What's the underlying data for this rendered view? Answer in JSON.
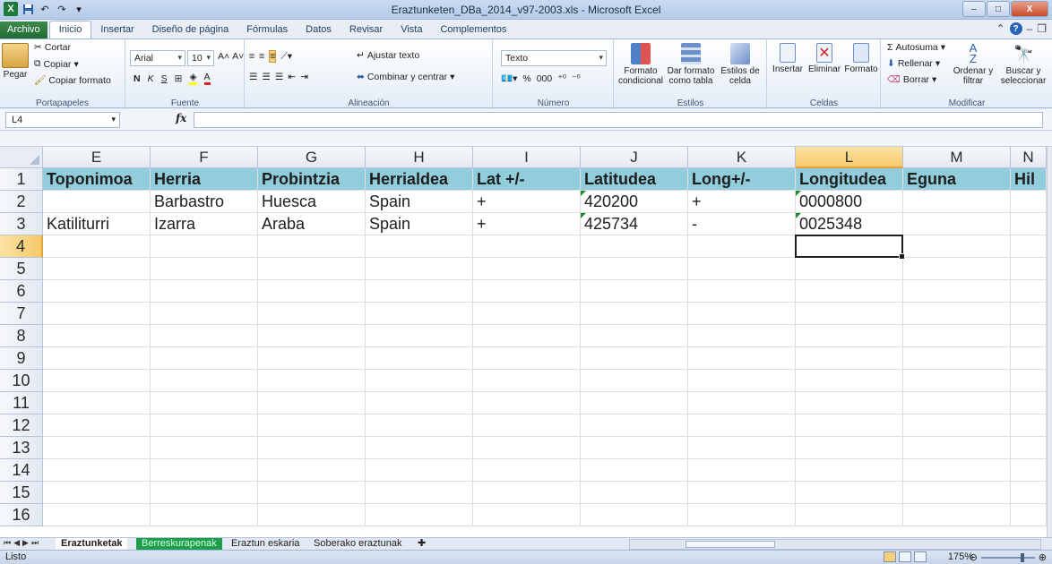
{
  "window": {
    "title": "Eraztunketen_DBa_2014_v97-2003.xls - Microsoft Excel",
    "app_logo": "X",
    "controls": {
      "minimize": "–",
      "maximize": "□",
      "close": "X"
    }
  },
  "ribbon_tabs": [
    "Archivo",
    "Inicio",
    "Insertar",
    "Diseño de página",
    "Fórmulas",
    "Datos",
    "Revisar",
    "Vista",
    "Complementos"
  ],
  "active_tab": "Inicio",
  "ribbon": {
    "clipboard": {
      "paste": "Pegar",
      "cut": "Cortar",
      "copy": "Copiar",
      "copy_format": "Copiar formato",
      "label": "Portapapeles"
    },
    "font": {
      "name": "Arial",
      "size": "10",
      "bold": "N",
      "italic": "K",
      "underline": "S",
      "label": "Fuente"
    },
    "alignment": {
      "wrap": "Ajustar texto",
      "merge": "Combinar y centrar",
      "label": "Alineación"
    },
    "number": {
      "format": "Texto",
      "percent": "%",
      "thousands": "000",
      "label": "Número"
    },
    "styles": {
      "cond_format": "Formato condicional",
      "table_format": "Dar formato como tabla",
      "cell_styles": "Estilos de celda",
      "label": "Estilos"
    },
    "cells": {
      "insert": "Insertar",
      "delete": "Eliminar",
      "format": "Formato",
      "label": "Celdas"
    },
    "editing": {
      "autosum": "Autosuma",
      "fill": "Rellenar",
      "clear": "Borrar",
      "sort": "Ordenar y filtrar",
      "find": "Buscar y seleccionar",
      "label": "Modificar"
    }
  },
  "formula_bar": {
    "name_box": "L4",
    "fx": "fx",
    "formula": ""
  },
  "columns": [
    "E",
    "F",
    "G",
    "H",
    "I",
    "J",
    "K",
    "L",
    "M",
    "N"
  ],
  "selected_column": "L",
  "rows": [
    "1",
    "2",
    "3",
    "4",
    "5",
    "6",
    "7",
    "8",
    "9",
    "10",
    "11",
    "12",
    "13",
    "14",
    "15",
    "16"
  ],
  "selected_row": "4",
  "headers": [
    "Toponimoa",
    "Herria",
    "Probintzia",
    "Herrialdea",
    "Lat +/-",
    "Latitudea",
    "Long+/-",
    "Longitudea",
    "Eguna",
    "Hil"
  ],
  "data_rows": [
    [
      "",
      "Barbastro",
      "Huesca",
      "Spain",
      "+",
      "420200",
      "+",
      "0000800",
      "",
      ""
    ],
    [
      "Katiliturri",
      "Izarra",
      "Araba",
      "Spain",
      "+",
      "425734",
      "-",
      "0025348",
      "",
      ""
    ]
  ],
  "sheet_tabs": [
    "Eraztunketak",
    "Berreskurapenak",
    "Eraztun eskaria",
    "Soberako eraztunak"
  ],
  "active_sheet": "Eraztunketak",
  "status": {
    "ready": "Listo",
    "zoom": "175%"
  },
  "colors": {
    "header_fill": "#92cddc",
    "selection": "#f7c96a",
    "file_tab": "#1f6b33"
  }
}
